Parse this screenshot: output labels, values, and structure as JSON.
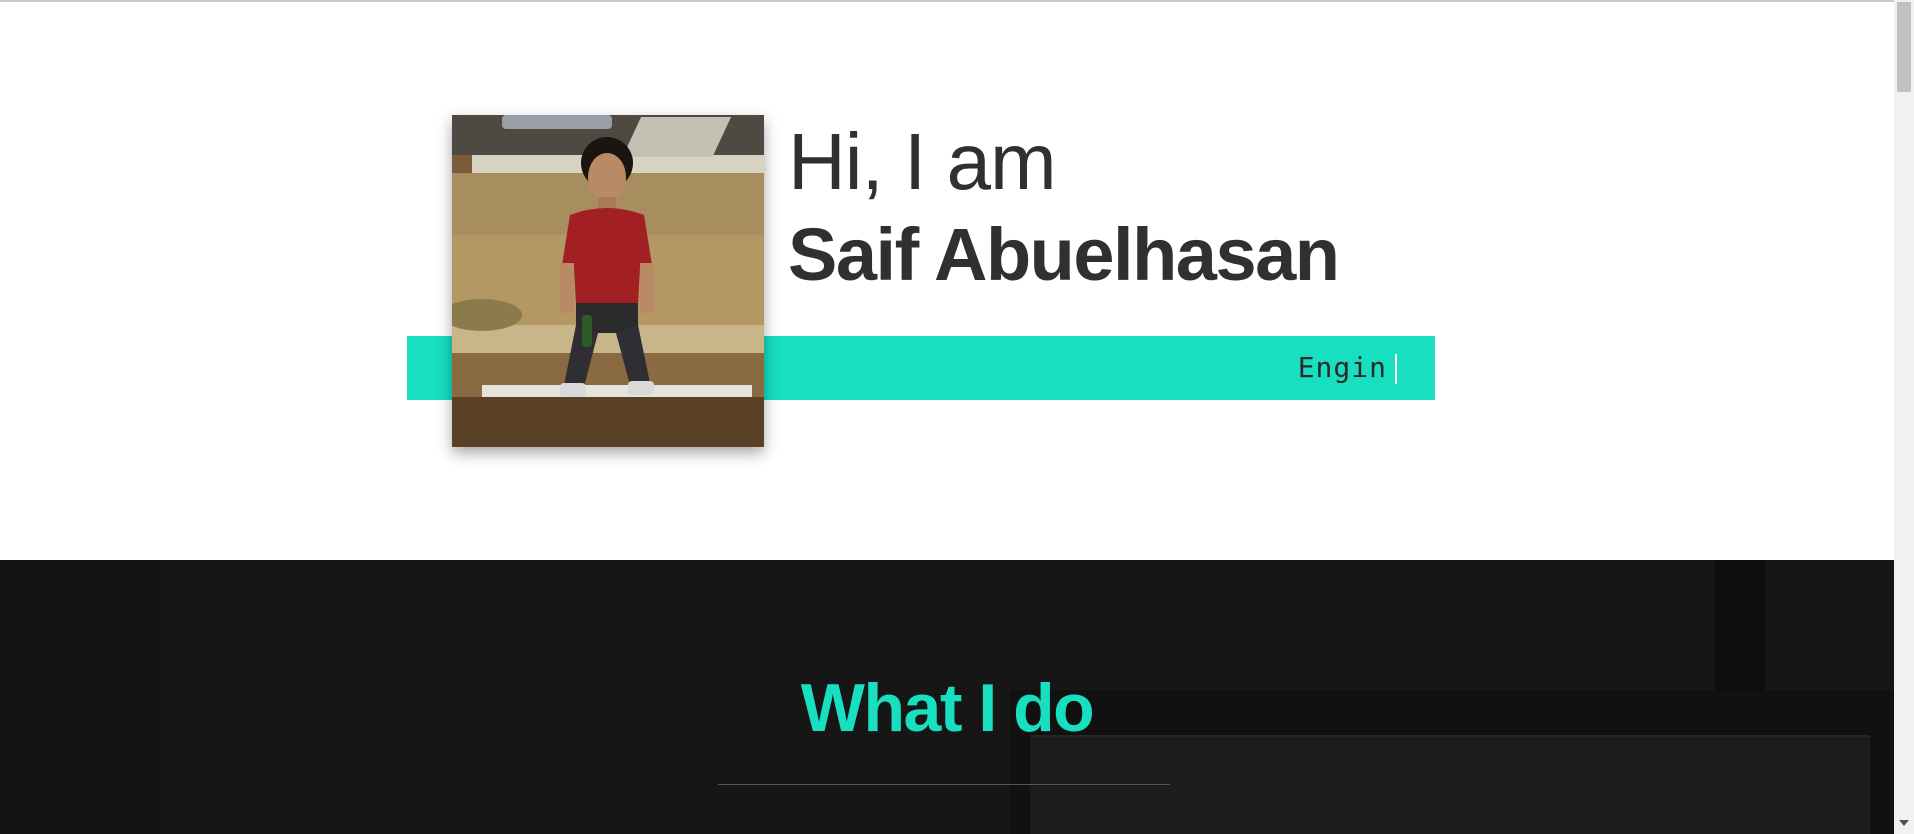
{
  "hero": {
    "greeting": "Hi, I am",
    "name": "Saif Abuelhasan",
    "typed_text": "Engin",
    "accent_color": "#17dfc0",
    "text_color": "#303030"
  },
  "avatar": {
    "description_icon": "profile-photo"
  },
  "what_i_do": {
    "title": "What I do",
    "background_color": "#161616",
    "title_color": "#17dfc0"
  },
  "scrollbar": {
    "thumb_color": "#c1c1c1",
    "track_color": "#f1f1f1"
  }
}
